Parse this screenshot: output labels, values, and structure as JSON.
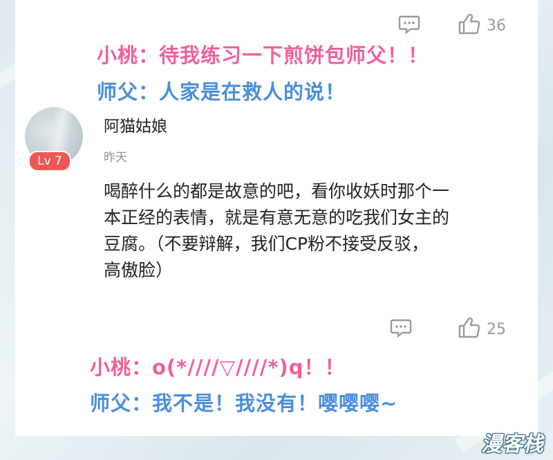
{
  "top_actions": {
    "likes": "36"
  },
  "dialogue_top": [
    {
      "text": "小桃：待我练习一下煎饼包师父！！",
      "color": "#f0609a"
    },
    {
      "text": "师父：人家是在救人的说！",
      "color": "#4a8ede"
    }
  ],
  "comment": {
    "username": "阿猫姑娘",
    "level": "Lv 7",
    "time": "昨天",
    "lines": [
      "喝醉什么的都是故意的吧，看你收妖时那个一",
      "本正经的表情，就是有意无意的吃我们女主的",
      "豆腐。（不要辩解，我们CP粉不接受反驳，",
      "高傲脸）"
    ],
    "likes": "25"
  },
  "dialogue_bottom": [
    {
      "text": "小桃：o(*////▽////*)q！！",
      "color": "#f0609a"
    },
    {
      "text": "师父：我不是！我没有！嘤嘤嘤~",
      "color": "#4a8ede"
    }
  ],
  "icons": [
    "comment-icon",
    "thumbs-up-icon"
  ],
  "watermark": "漫客栈"
}
